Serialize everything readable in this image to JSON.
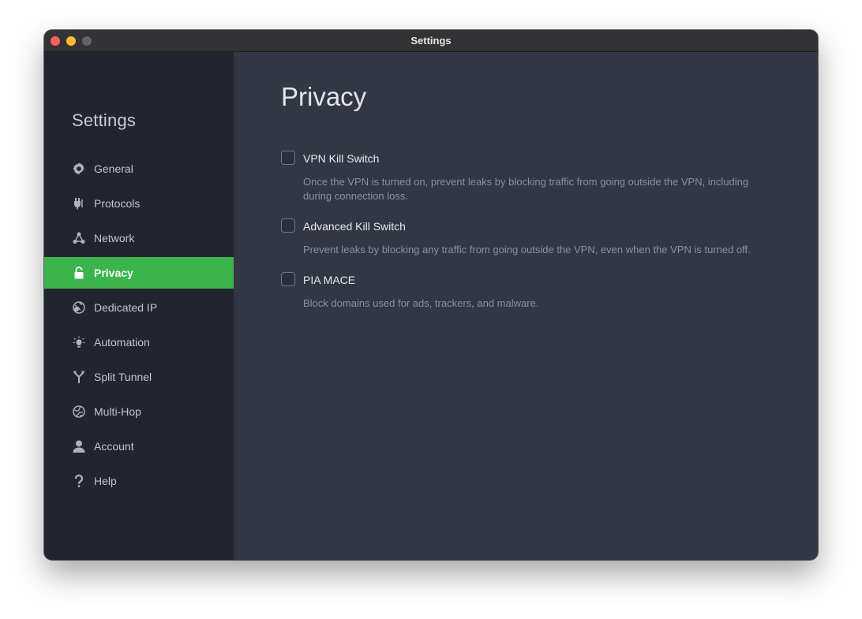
{
  "window": {
    "title": "Settings"
  },
  "sidebar": {
    "title": "Settings",
    "items": [
      {
        "label": "General",
        "icon": "gear-icon"
      },
      {
        "label": "Protocols",
        "icon": "protocols-icon"
      },
      {
        "label": "Network",
        "icon": "network-icon"
      },
      {
        "label": "Privacy",
        "icon": "lock-icon",
        "active": true
      },
      {
        "label": "Dedicated IP",
        "icon": "dedicated-ip-icon"
      },
      {
        "label": "Automation",
        "icon": "automation-icon"
      },
      {
        "label": "Split Tunnel",
        "icon": "split-tunnel-icon"
      },
      {
        "label": "Multi-Hop",
        "icon": "multi-hop-icon"
      },
      {
        "label": "Account",
        "icon": "account-icon"
      },
      {
        "label": "Help",
        "icon": "help-icon"
      }
    ]
  },
  "main": {
    "title": "Privacy",
    "options": [
      {
        "label": "VPN Kill Switch",
        "checked": false,
        "description": "Once the VPN is turned on, prevent leaks by blocking traffic from going outside the VPN, including during connection loss."
      },
      {
        "label": "Advanced Kill Switch",
        "checked": false,
        "description": "Prevent leaks by blocking any traffic from going outside the VPN, even when the VPN is turned off."
      },
      {
        "label": "PIA MACE",
        "checked": false,
        "description": "Block domains used for ads, trackers, and malware."
      }
    ]
  },
  "colors": {
    "accent": "#3bb54b",
    "sidebar_bg": "#22252e",
    "main_bg": "#323743"
  }
}
